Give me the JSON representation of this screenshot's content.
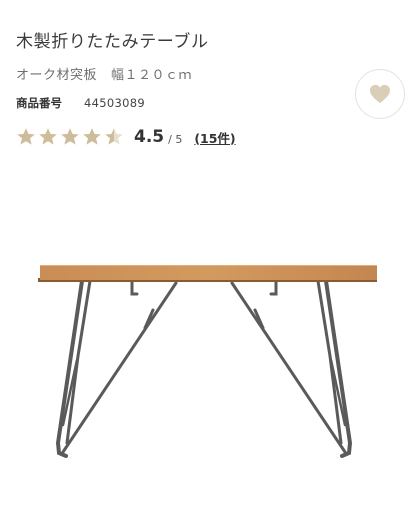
{
  "product": {
    "title": "木製折りたたみテーブル",
    "material": "オーク材突板",
    "size": "幅１２０ｃｍ",
    "item_number_label": "商品番号",
    "item_number": "44503089"
  },
  "rating": {
    "value": "4.5",
    "max": "/ 5",
    "review_count": "(15件)",
    "stars": 4.5,
    "star_color": "#cdbd9b"
  },
  "favorite": {
    "icon": "heart-icon",
    "icon_color": "#d9cfb8"
  },
  "image": {
    "subject": "table-photo",
    "top_color": "#c98d55",
    "frame_color": "#5a5a5a"
  }
}
